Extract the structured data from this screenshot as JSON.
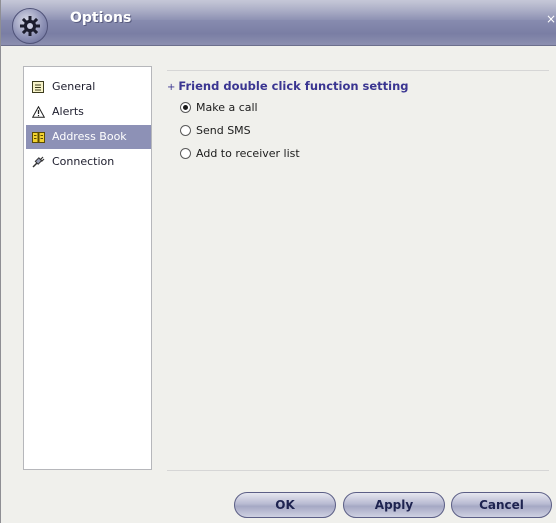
{
  "window": {
    "title": "Options",
    "close_glyph": "×"
  },
  "sidebar": {
    "items": [
      {
        "label": "General",
        "icon": "general-icon",
        "selected": false
      },
      {
        "label": "Alerts",
        "icon": "alert-icon",
        "selected": false
      },
      {
        "label": "Address Book",
        "icon": "address-book-icon",
        "selected": true
      },
      {
        "label": "Connection",
        "icon": "connection-icon",
        "selected": false
      }
    ]
  },
  "content": {
    "section_bullet": "+",
    "section_title": "Friend double click function setting",
    "options": [
      {
        "label": "Make a call",
        "checked": true
      },
      {
        "label": "Send SMS",
        "checked": false
      },
      {
        "label": "Add to receiver list",
        "checked": false
      }
    ]
  },
  "buttons": {
    "ok": "OK",
    "apply": "Apply",
    "cancel": "Cancel"
  },
  "colors": {
    "titlebar": "#8a8eb1",
    "selection": "#8d91b6",
    "section_title": "#3a3591"
  }
}
